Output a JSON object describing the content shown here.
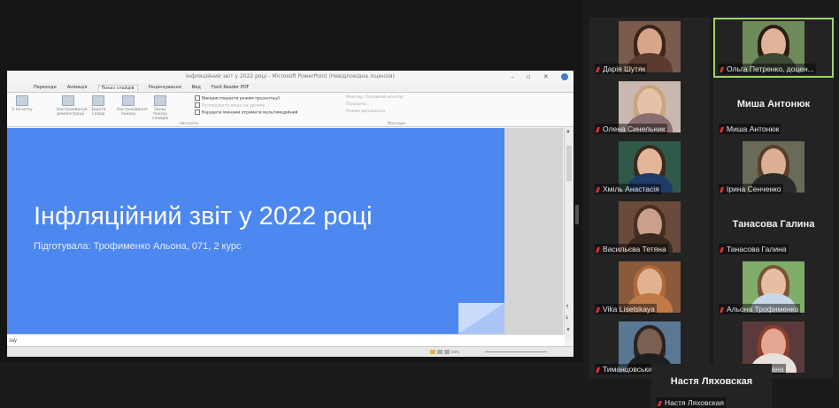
{
  "powerpoint": {
    "title": "Інфляційний звіт у 2022 році - Microsoft PowerPoint (Невідповідна ліцензія)",
    "window_controls": "–  ▫  ✕",
    "tabs": [
      "Переходи",
      "Анімація",
      "Показ слайдів",
      "Рецензування",
      "Вид",
      "Foxit Reader PDF"
    ],
    "active_tab_index": 2,
    "ribbon_buttons": [
      "З початку",
      "Настроювання демонстрації",
      "Задати слайд",
      "Настроювання показу",
      "Запис показу слайдів"
    ],
    "checks": [
      "Використовувати режим презентації",
      "Розташувати лише на одному",
      "Керувати іменами отримати мультимедійний"
    ],
    "checks_faded": [
      false,
      true,
      false
    ],
    "group_label_setup": "Настроїти",
    "right_group": [
      "Монітор: Основний монітор",
      "Показати...",
      "Режим доповідача"
    ],
    "group_label_monitors": "Монітори",
    "slide_title": "Інфляційний звіт у 2022 році",
    "slide_subtitle": "Підготувала: Трофименко Альона, 071, 2 курс",
    "notes_placeholder": "зау",
    "zoom_text": "65%"
  },
  "participants": [
    {
      "name": "Дарія Шутяк",
      "type": "video",
      "skin": "#d9a58a",
      "hair": "#3b2418",
      "bg": "#7a5b4c",
      "top": "#5a3b2d"
    },
    {
      "name": "Ольга Петренко, доцен...",
      "type": "video",
      "skin": "#e1b49a",
      "hair": "#2a1e17",
      "bg": "#6f8a5a",
      "top": "#3c4a34",
      "active": true
    },
    {
      "name": "Олена Синельник",
      "type": "video",
      "skin": "#e7c0a8",
      "hair": "#c8a57a",
      "bg": "#c9b8b0",
      "top": "#8a6f70"
    },
    {
      "name": "Миша Антонюк",
      "type": "name",
      "big_name": "Миша Антонюк"
    },
    {
      "name": "Хміль Анастасія",
      "type": "video",
      "skin": "#e4b699",
      "hair": "#3a2a1f",
      "bg": "#2f5a4a",
      "top": "#1f3b6a"
    },
    {
      "name": "Ірина Сенченко",
      "type": "video",
      "skin": "#dcb094",
      "hair": "#5a3e2c",
      "bg": "#6a6a58",
      "top": "#2a2a2a"
    },
    {
      "name": "Васильєва Тетяна",
      "type": "video",
      "skin": "#caa08a",
      "hair": "#4a2e22",
      "bg": "#6a4a3a",
      "top": "#3a2a22"
    },
    {
      "name": "Танасова Галина",
      "type": "name",
      "big_name": "Танасова Галина"
    },
    {
      "name": "Vika Lisetskaya",
      "type": "video",
      "skin": "#e0b290",
      "hair": "#b06a3a",
      "bg": "#8a5a3a",
      "top": "#c07a48"
    },
    {
      "name": "Альона Трофименко",
      "type": "video",
      "skin": "#e6bfa2",
      "hair": "#7a5436",
      "bg": "#7fae6a",
      "top": "#c9d8e8"
    },
    {
      "name": "Тиманцовський Андрій",
      "type": "video",
      "skin": "#7a6050",
      "hair": "#2a2320",
      "bg": "#5a7894",
      "top": "#1e1e1e"
    },
    {
      "name": "Пласун Руслана",
      "type": "video",
      "skin": "#e2a892",
      "hair": "#8a3e2e",
      "bg": "#5a3a3a",
      "top": "#e8e0da"
    },
    {
      "name": "Настя Ляховская",
      "type": "name",
      "big_name": "Настя Ляховская"
    }
  ]
}
